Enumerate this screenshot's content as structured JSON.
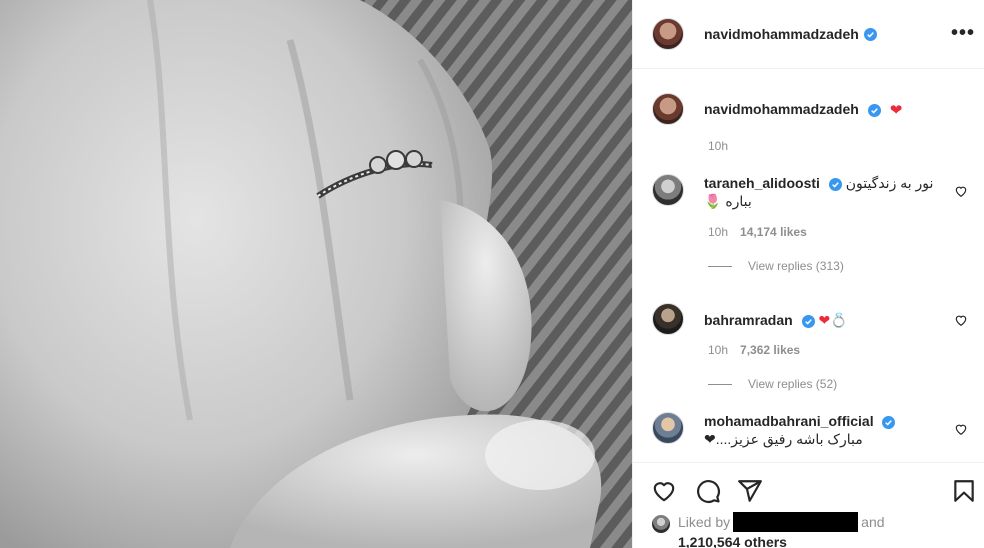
{
  "post": {
    "author": "navidmohammadzadeh",
    "more_icon": "more-options-icon",
    "photo_alt": "Black and white photo of two hands, one wearing a diamond ring"
  },
  "caption": {
    "author": "navidmohammadzadeh",
    "emoji": "❤",
    "time": "10h"
  },
  "comments": [
    {
      "user": "taraneh_alidoosti",
      "text": "نور به زندگیتون بباره 🌷",
      "time": "10h",
      "likes": "14,174 likes",
      "replies": "View replies (313)"
    },
    {
      "user": "bahramradan",
      "text": "❤💍",
      "time": "10h",
      "likes": "7,362 likes",
      "replies": "View replies (52)"
    },
    {
      "user": "mohamadbahrani_official",
      "text": "مبارک باشه رفیق عزیز....❤",
      "time": "",
      "likes": "",
      "replies": ""
    }
  ],
  "actions": {
    "like_icon": "heart-outline-icon",
    "comment_icon": "comment-icon",
    "share_icon": "paper-plane-icon",
    "save_icon": "bookmark-icon"
  },
  "liked_by": {
    "prefix": "Liked by",
    "and": "and",
    "count": "1,210,564 others"
  },
  "colors": {
    "verified": "#3897f0",
    "heart": "#ed2a3a",
    "muted": "#8e8e8e"
  }
}
